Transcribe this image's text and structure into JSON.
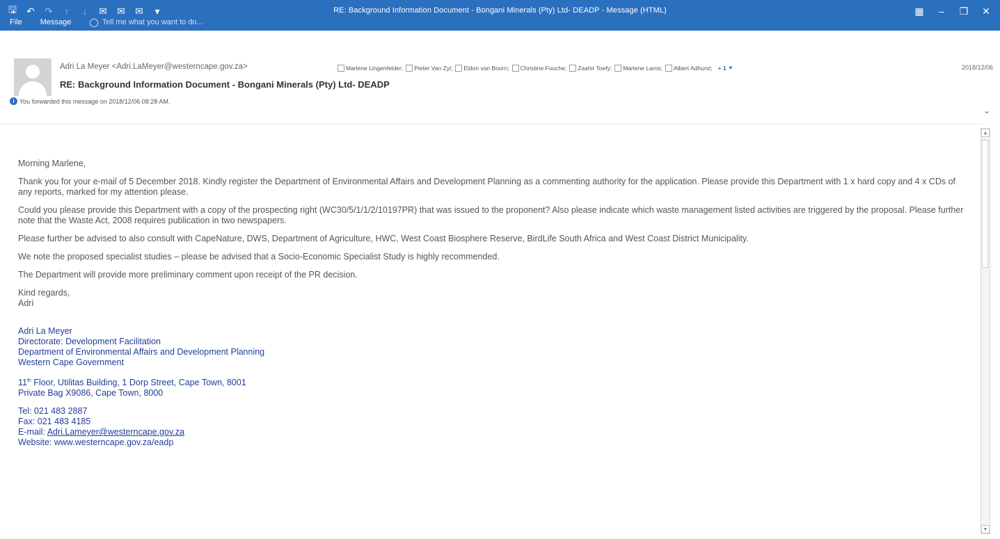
{
  "window": {
    "title": "RE: Background Information Document - Bongani Minerals (Pty) Ltd- DEADP - Message (HTML)"
  },
  "quick_access": [
    "save-icon",
    "undo-icon",
    "redo-icon",
    "arrow-up-icon",
    "arrow-down-icon",
    "reply-icon",
    "reply-all-icon",
    "forward-icon",
    "customize-icon"
  ],
  "ribbon": {
    "tabs": [
      "File",
      "Message"
    ],
    "tell_me": "Tell me what you want to do..."
  },
  "header": {
    "sender": "Adri La Meyer <Adri.LaMeyer@westerncape.gov.za>",
    "recipients": [
      "Marlene Lingenfelder;",
      "Pieter Van Zyl;",
      "Eldon van Boorn;",
      "Christine Fouche;",
      "Zaahir Toefy;",
      "Marlene Laros;",
      "Albert Adhurst;"
    ],
    "more_recipients": "+ 1",
    "date": "2018/12/06",
    "subject": "RE: Background Information Document - Bongani Minerals (Pty) Ltd- DEADP",
    "info": "You forwarded this message on 2018/12/06 08:28 AM."
  },
  "message": {
    "greeting": "Morning Marlene,",
    "paragraphs": [
      "Thank you for your e-mail of 5 December 2018. Kindly register the Department of Environmental Affairs and Development Planning as a commenting authority for the application. Please provide this Department with 1 x hard copy and 4 x CDs of any reports, marked for my attention please.",
      "Could you please provide this Department with a copy of the prospecting right (WC30/5/1/1/2/10197PR) that was issued to the proponent? Also please indicate which waste management listed activities are triggered by the proposal. Please further note that the Waste Act, 2008 requires publication in two newspapers.",
      "Please further be advised to also consult with CapeNature, DWS, Department of Agriculture, HWC, West Coast Biosphere Reserve, BirdLife South Africa and West Coast District Municipality.",
      "We note the proposed specialist studies – please be advised that a Socio-Economic Specialist Study is highly recommended.",
      "The Department will provide more preliminary comment upon receipt of the PR decision."
    ],
    "closing": "Kind regards,",
    "closing_name": "Adri"
  },
  "signature": {
    "name": "Adri La Meyer",
    "directorate": "Directorate: Development Facilitation",
    "department": "Department of Environmental Affairs and Development Planning",
    "government": "Western Cape Government",
    "address_floor": "11",
    "address_floor_sup": "th",
    "address_rest": " Floor, Utilitas Building, 1 Dorp Street, Cape Town, 8001",
    "private_bag": "Private Bag X9086, Cape Town, 8000",
    "tel": "Tel: 021 483 2887",
    "fax": "Fax: 021 483 4185",
    "email_label": "E-mail: ",
    "email": "Adri.Lameyer@westerncape.gov.za",
    "website": "Website: www.westerncape.gov.za/eadp"
  }
}
